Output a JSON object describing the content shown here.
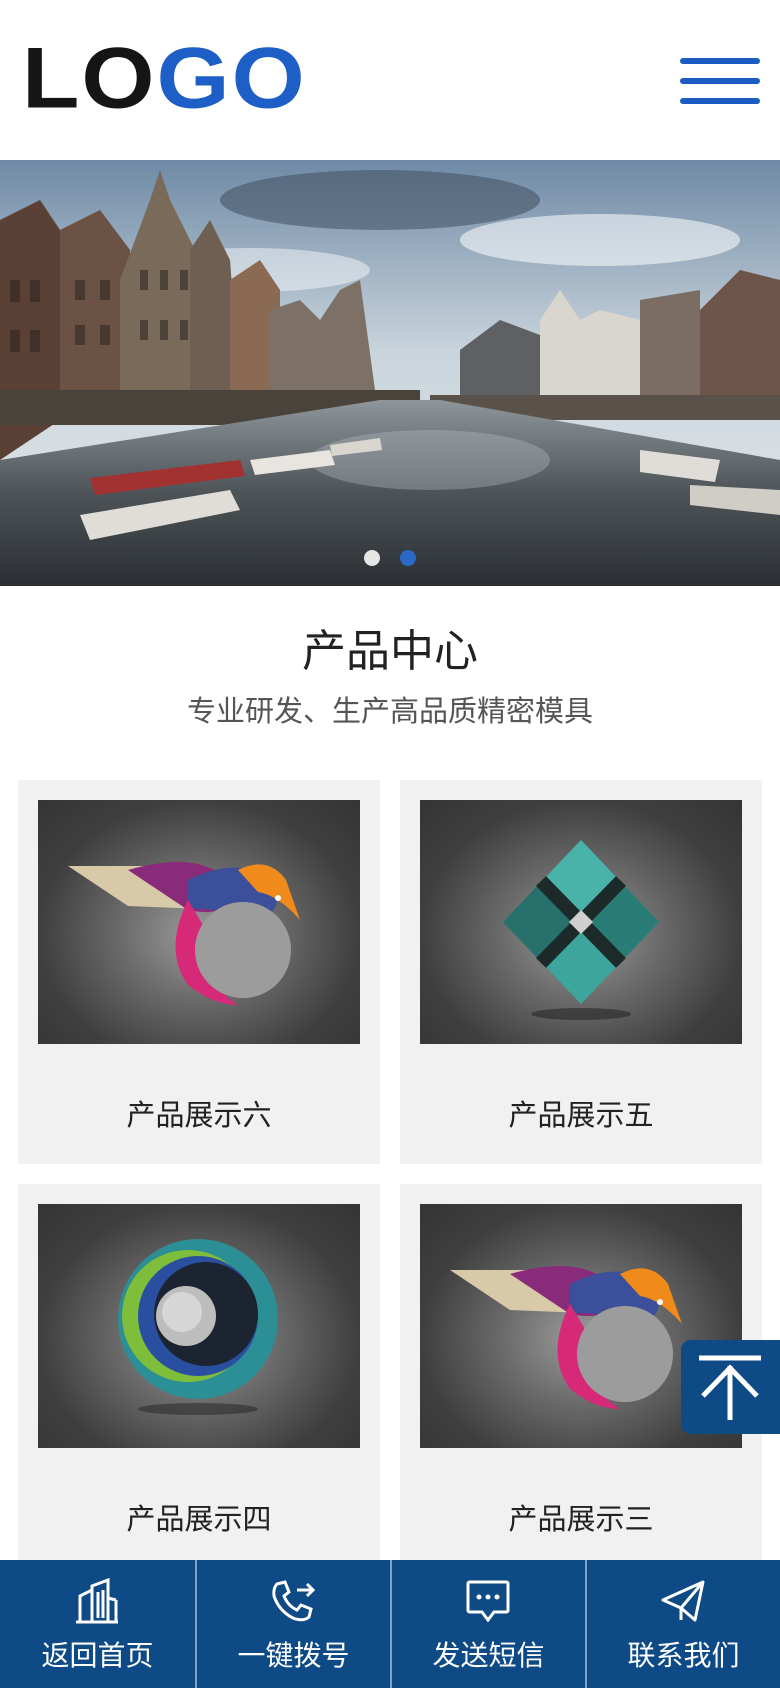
{
  "header": {
    "logo_dark": "LO",
    "logo_accent": "GO"
  },
  "banner": {
    "slides_total": 2,
    "active_slide": 2
  },
  "products": {
    "title": "产品中心",
    "subtitle": "专业研发、生产高品质精密模具",
    "items": [
      {
        "label": "产品展示六",
        "icon": "bird-logo-icon"
      },
      {
        "label": "产品展示五",
        "icon": "diamond-logo-icon"
      },
      {
        "label": "产品展示四",
        "icon": "ring-logo-icon"
      },
      {
        "label": "产品展示三",
        "icon": "bird-logo-icon"
      }
    ]
  },
  "bottom_nav": [
    {
      "label": "返回首页",
      "icon": "building-icon"
    },
    {
      "label": "一键拨号",
      "icon": "phone-icon"
    },
    {
      "label": "发送短信",
      "icon": "message-icon"
    },
    {
      "label": "联系我们",
      "icon": "paper-plane-icon"
    }
  ],
  "colors": {
    "brand_blue": "#1d5fc6",
    "nav_bg": "#0d4a86",
    "card_bg": "#f1f1f1"
  }
}
